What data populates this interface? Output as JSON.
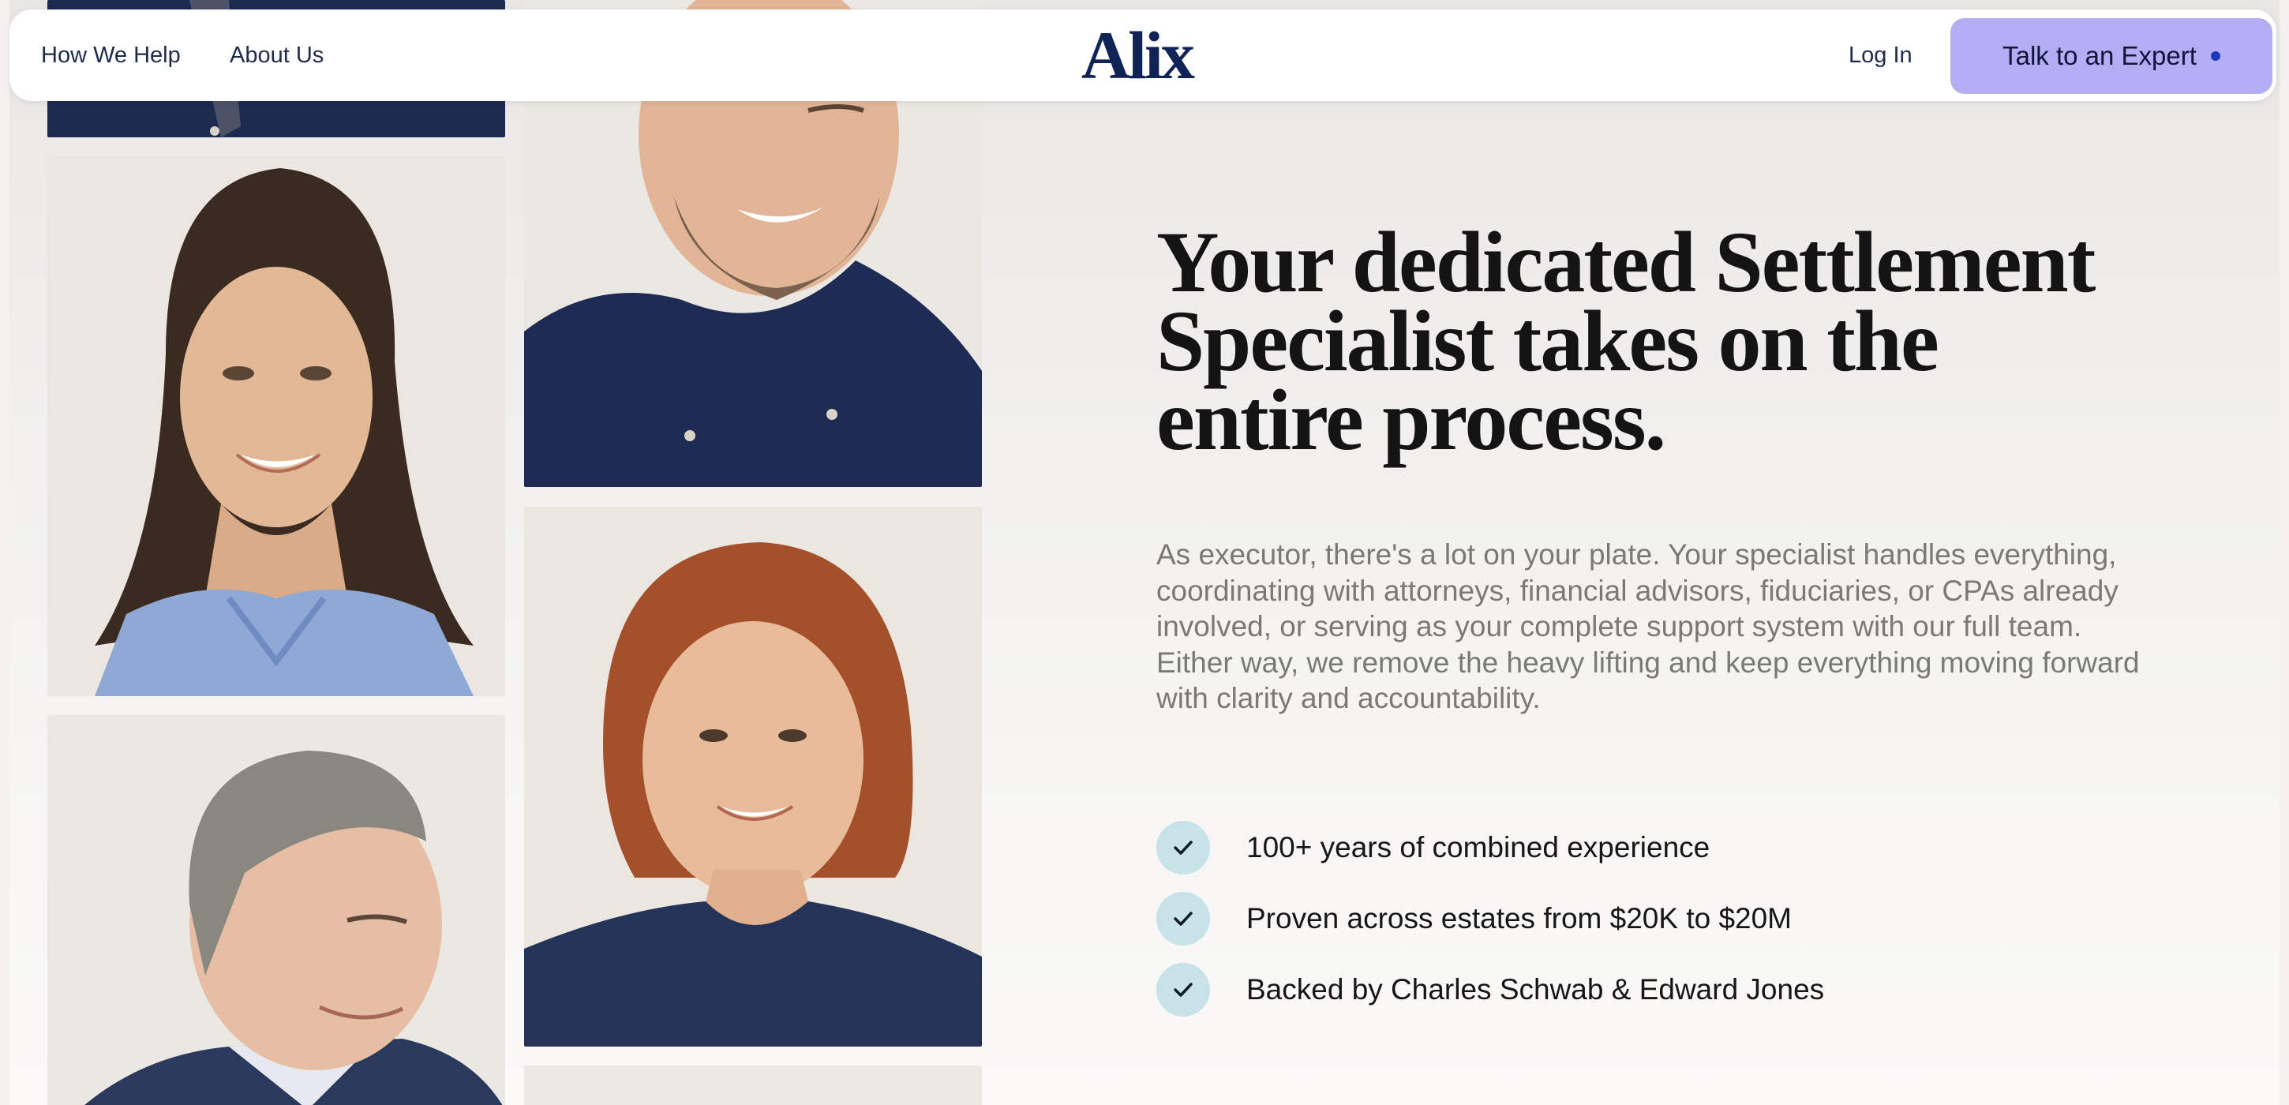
{
  "nav": {
    "links": [
      "How We Help",
      "About Us"
    ],
    "logo": "Alix",
    "login": "Log In",
    "cta": "Talk to an Expert"
  },
  "main": {
    "heading_lines": [
      "Your dedicated Settlement",
      "Specialist takes on the",
      "entire process."
    ],
    "body": "As executor, there's a lot on your plate. Your specialist handles everything, coordinating with attorneys, financial advisors, fiduciaries, or CPAs already involved, or serving as your complete support system with our full team. Either way, we remove the heavy lifting and keep everything moving forward with clarity and accountability.",
    "features": [
      "100+ years of combined experience",
      "Proven across estates from $20K to $20M",
      "Backed by Charles Schwab & Edward Jones"
    ]
  },
  "icons": {
    "check": "check-icon",
    "cta_dot": "dot-icon"
  },
  "colors": {
    "brand": "#0f2357",
    "cta_bg": "#b3adf4",
    "check_bg": "#c8e3e7"
  }
}
